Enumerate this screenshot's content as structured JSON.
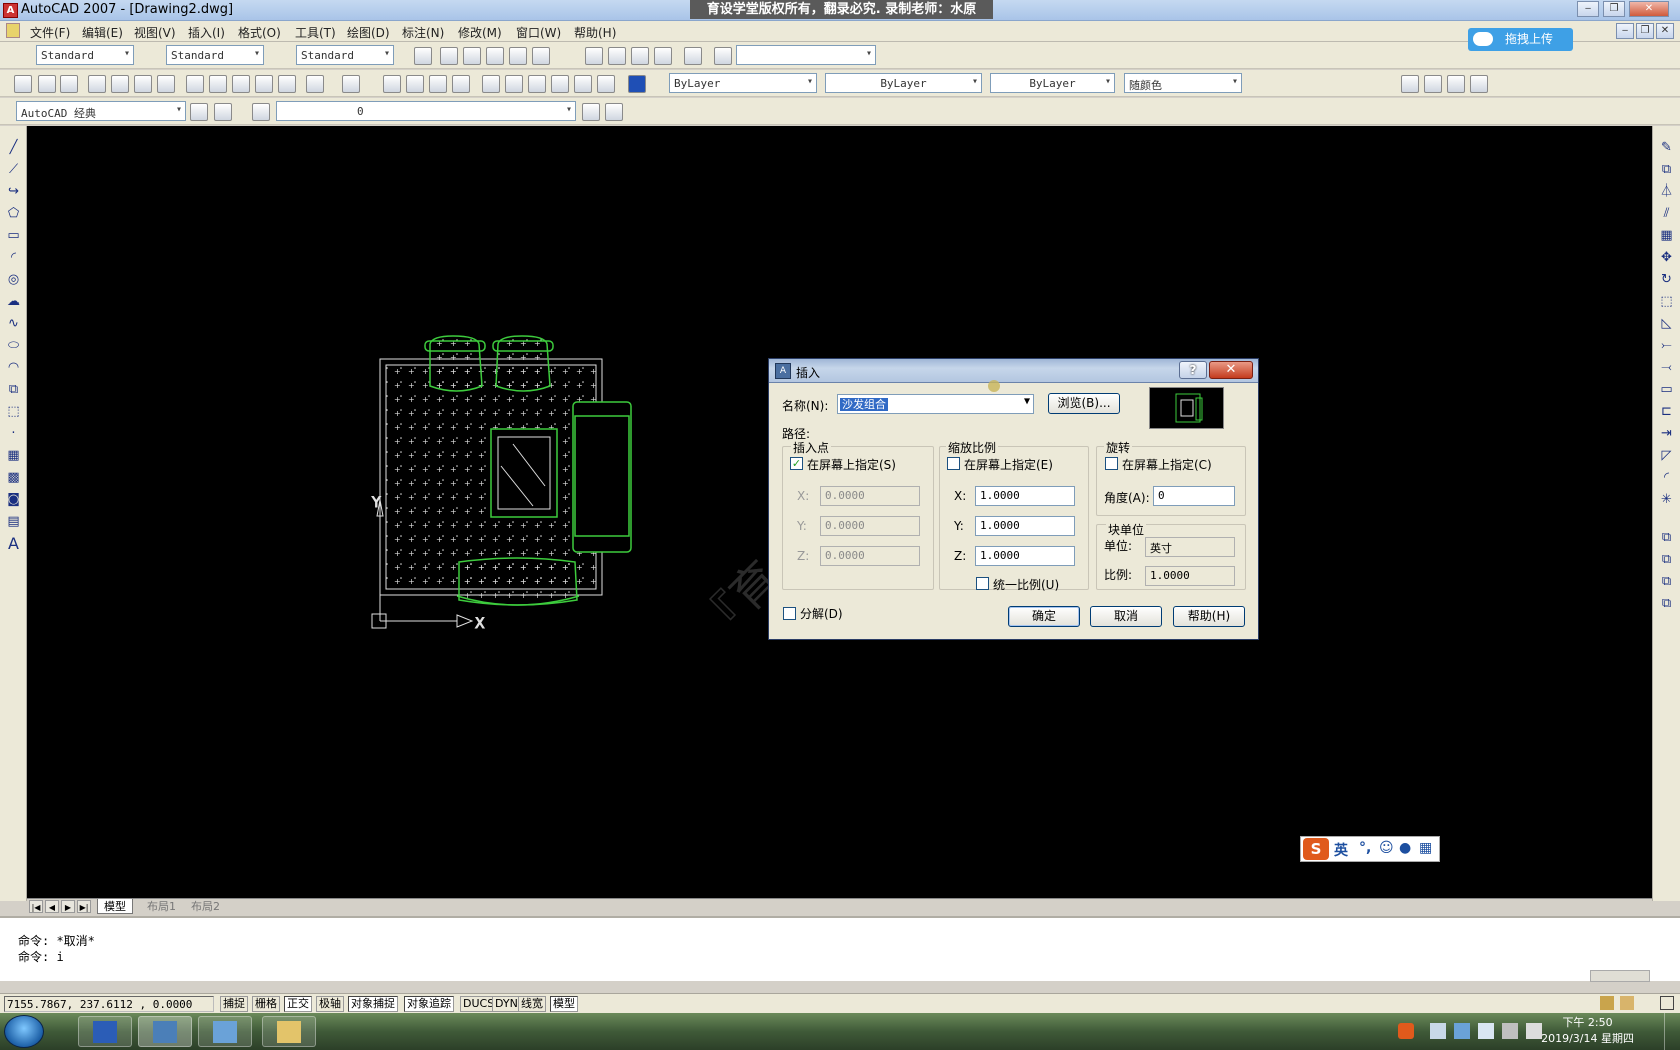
{
  "window": {
    "title": "AutoCAD 2007 - [Drawing2.dwg]",
    "watermark": "育设学堂版权所有，翻录必究. 录制老师：水原"
  },
  "menu": [
    "文件(F)",
    "编辑(E)",
    "视图(V)",
    "插入(I)",
    "格式(O)",
    "工具(T)",
    "绘图(D)",
    "标注(N)",
    "修改(M)",
    "窗口(W)",
    "帮助(H)"
  ],
  "toolbar": {
    "text_style": "Standard",
    "dim_style": "Standard",
    "table_style": "Standard",
    "workspace": "AutoCAD 经典",
    "layer": "0",
    "color": "ByLayer",
    "linetype": "ByLayer",
    "lineweight": "ByLayer",
    "plot_style": "随颜色",
    "upload_label": "拖拽上传"
  },
  "layout_tabs": [
    "模型",
    "布局1",
    "布局2"
  ],
  "command": {
    "line1": "命令: *取消*",
    "line2": "命令: i"
  },
  "status": {
    "coords": "7155.7867, 237.6112 , 0.0000",
    "buttons": [
      {
        "label": "捕捉",
        "on": false
      },
      {
        "label": "栅格",
        "on": false
      },
      {
        "label": "正交",
        "on": true
      },
      {
        "label": "极轴",
        "on": false
      },
      {
        "label": "对象捕捉",
        "on": true
      },
      {
        "label": "对象追踪",
        "on": true
      },
      {
        "label": "DUCS",
        "on": false
      },
      {
        "label": "DYN",
        "on": false
      },
      {
        "label": "线宽",
        "on": false
      },
      {
        "label": "模型",
        "on": true
      }
    ]
  },
  "taskbar": {
    "time": "下午 2:50",
    "date": "2019/3/14 星期四"
  },
  "ime": {
    "label": "英"
  },
  "dialog": {
    "title": "插入",
    "help_glyph": "?",
    "close_glyph": "✕",
    "name_label": "名称(N):",
    "name_value": "沙发组合",
    "browse_label": "浏览(B)...",
    "path_label": "路径:",
    "insertion": {
      "title": "插入点",
      "onscreen_label": "在屏幕上指定(S)",
      "onscreen_checked": true,
      "x_label": "X:",
      "x_value": "0.0000",
      "y_label": "Y:",
      "y_value": "0.0000",
      "z_label": "Z:",
      "z_value": "0.0000"
    },
    "scale": {
      "title": "缩放比例",
      "onscreen_label": "在屏幕上指定(E)",
      "onscreen_checked": false,
      "x_label": "X:",
      "x_value": "1.0000",
      "y_label": "Y:",
      "y_value": "1.0000",
      "z_label": "Z:",
      "z_value": "1.0000",
      "uniform_label": "统一比例(U)"
    },
    "rotation": {
      "title": "旋转",
      "onscreen_label": "在屏幕上指定(C)",
      "angle_label": "角度(A):",
      "angle_value": "0"
    },
    "block_unit": {
      "title": "块单位",
      "unit_label": "单位:",
      "unit_value": "英寸",
      "ratio_label": "比例:",
      "ratio_value": "1.0000"
    },
    "explode_label": "分解(D)",
    "ok_label": "确定",
    "cancel_label": "取消",
    "help_label": "帮助(H)"
  }
}
